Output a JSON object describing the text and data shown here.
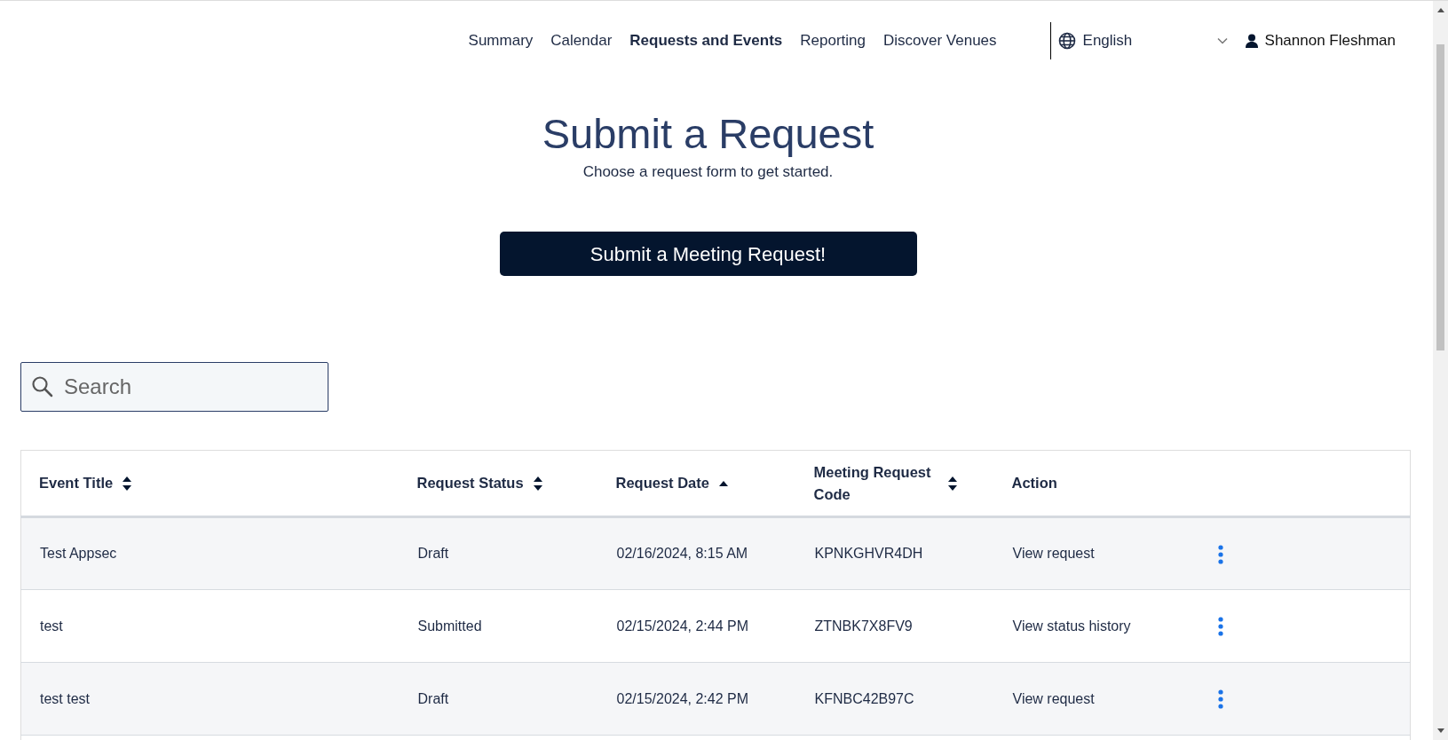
{
  "nav": {
    "links": [
      {
        "label": "Summary",
        "selected": false
      },
      {
        "label": "Calendar",
        "selected": false
      },
      {
        "label": "Requests and Events",
        "selected": true
      },
      {
        "label": "Reporting",
        "selected": false
      },
      {
        "label": "Discover Venues",
        "selected": false
      }
    ],
    "language": "English",
    "user": "Shannon Fleshman"
  },
  "header": {
    "title": "Submit a Request",
    "subtitle": "Choose a request form to get started.",
    "button": "Submit a Meeting Request!"
  },
  "search": {
    "placeholder": "Search"
  },
  "table": {
    "columns": [
      {
        "label": "Event Title",
        "sortable": true,
        "sorted": false
      },
      {
        "label": "Request Status",
        "sortable": true,
        "sorted": false
      },
      {
        "label": "Request Date",
        "sortable": true,
        "sorted": true
      },
      {
        "label": "Meeting Request Code",
        "sortable": true,
        "sorted": false
      },
      {
        "label": "Action",
        "sortable": false
      }
    ],
    "rows": [
      {
        "title": "Test Appsec",
        "status": "Draft",
        "date": "02/16/2024, 8:15 AM",
        "code": "KPNKGHVR4DH",
        "action": "View request"
      },
      {
        "title": "test",
        "status": "Submitted",
        "date": "02/15/2024, 2:44 PM",
        "code": "ZTNBK7X8FV9",
        "action": "View status history"
      },
      {
        "title": "test test",
        "status": "Draft",
        "date": "02/15/2024, 2:42 PM",
        "code": "KFNBC42B97C",
        "action": "View request"
      }
    ]
  }
}
